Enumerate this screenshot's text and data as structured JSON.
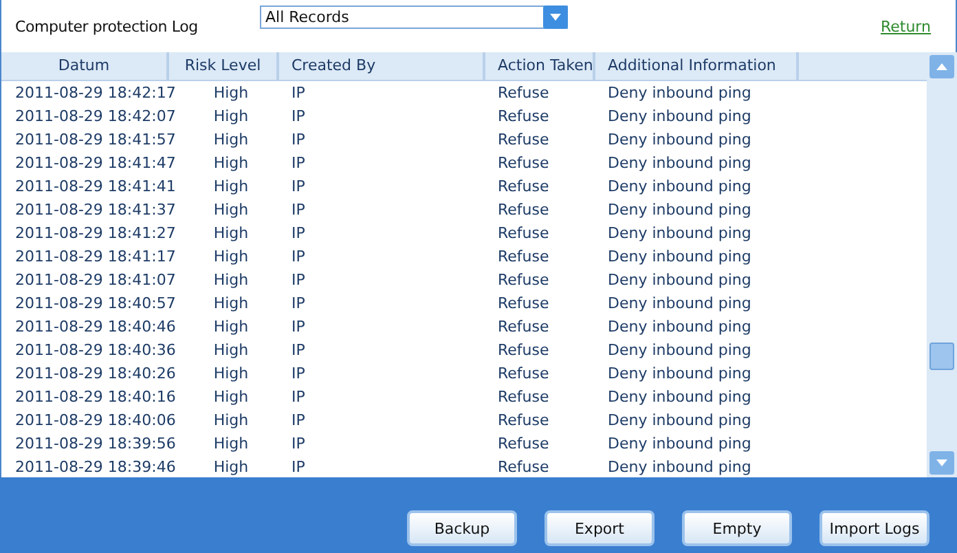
{
  "header": {
    "title": "Computer protection Log",
    "filter": {
      "value": "All Records"
    },
    "return_link": "Return"
  },
  "table": {
    "columns": [
      "Datum",
      "Risk Level",
      "Created By",
      "Action Taken",
      "Additional Information"
    ],
    "rows": [
      [
        "2011-08-29 18:42:17",
        "High",
        "IP",
        "Refuse",
        "Deny inbound ping"
      ],
      [
        "2011-08-29 18:42:07",
        "High",
        "IP",
        "Refuse",
        "Deny inbound ping"
      ],
      [
        "2011-08-29 18:41:57",
        "High",
        "IP",
        "Refuse",
        "Deny inbound ping"
      ],
      [
        "2011-08-29 18:41:47",
        "High",
        "IP",
        "Refuse",
        "Deny inbound ping"
      ],
      [
        "2011-08-29 18:41:41",
        "High",
        "IP",
        "Refuse",
        "Deny inbound ping"
      ],
      [
        "2011-08-29 18:41:37",
        "High",
        "IP",
        "Refuse",
        "Deny inbound ping"
      ],
      [
        "2011-08-29 18:41:27",
        "High",
        "IP",
        "Refuse",
        "Deny inbound ping"
      ],
      [
        "2011-08-29 18:41:17",
        "High",
        "IP",
        "Refuse",
        "Deny inbound ping"
      ],
      [
        "2011-08-29 18:41:07",
        "High",
        "IP",
        "Refuse",
        "Deny inbound ping"
      ],
      [
        "2011-08-29 18:40:57",
        "High",
        "IP",
        "Refuse",
        "Deny inbound ping"
      ],
      [
        "2011-08-29 18:40:46",
        "High",
        "IP",
        "Refuse",
        "Deny inbound ping"
      ],
      [
        "2011-08-29 18:40:36",
        "High",
        "IP",
        "Refuse",
        "Deny inbound ping"
      ],
      [
        "2011-08-29 18:40:26",
        "High",
        "IP",
        "Refuse",
        "Deny inbound ping"
      ],
      [
        "2011-08-29 18:40:16",
        "High",
        "IP",
        "Refuse",
        "Deny inbound ping"
      ],
      [
        "2011-08-29 18:40:06",
        "High",
        "IP",
        "Refuse",
        "Deny inbound ping"
      ],
      [
        "2011-08-29 18:39:56",
        "High",
        "IP",
        "Refuse",
        "Deny inbound ping"
      ],
      [
        "2011-08-29 18:39:46",
        "High",
        "IP",
        "Refuse",
        "Deny inbound ping"
      ]
    ]
  },
  "buttons": [
    "Backup",
    "Export",
    "Empty",
    "Import Logs"
  ]
}
